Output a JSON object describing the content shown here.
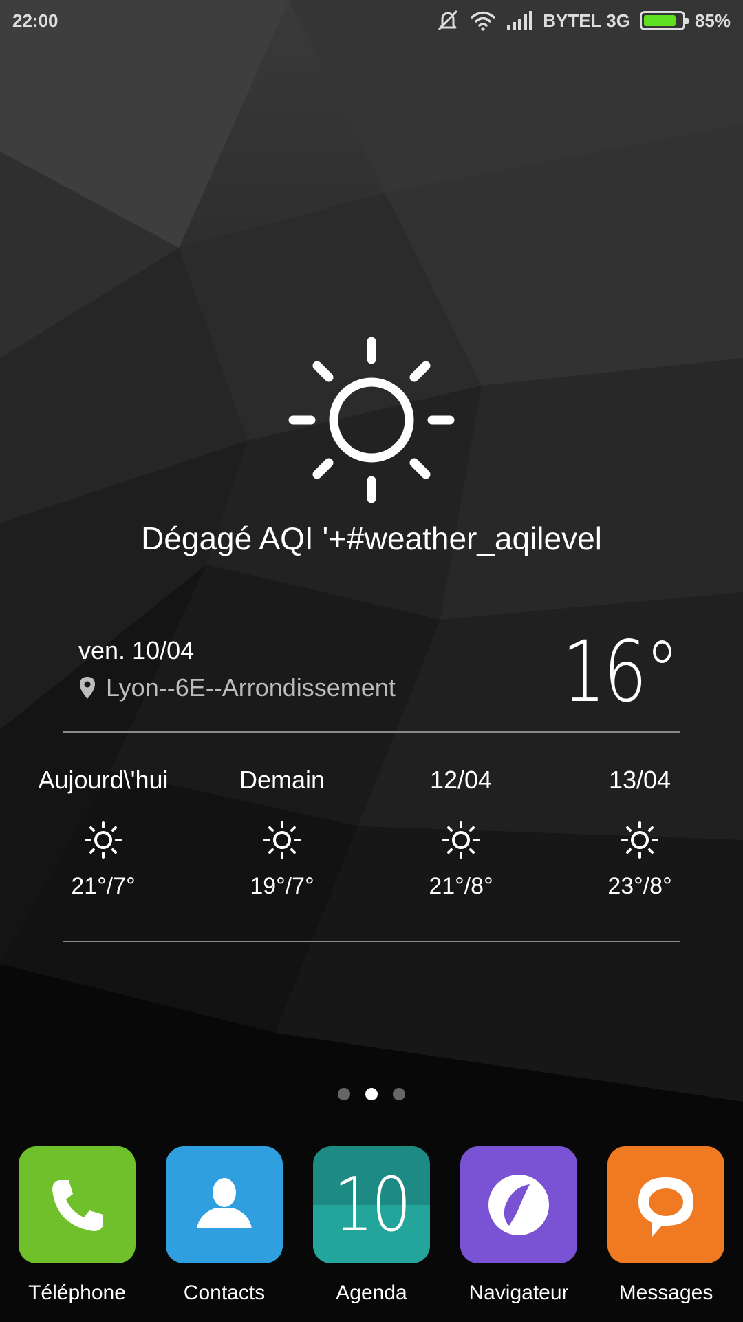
{
  "status_bar": {
    "time": "22:00",
    "carrier": "BYTEL 3G",
    "battery_percent_text": "85%",
    "battery_level": 0.85,
    "icons": [
      "mute-icon",
      "wifi-icon",
      "signal-icon",
      "battery-icon"
    ],
    "battery_color": "#5fe021"
  },
  "weather": {
    "condition": "Dégagé AQI '+#weather_aqilevel",
    "date": "ven. 10/04",
    "location": "Lyon--6E--Arrondissement",
    "current_temp": "16°",
    "icon": "sun-icon",
    "forecast": [
      {
        "label": "Aujourd\\'hui",
        "temps": "21°/7°",
        "icon": "sun-icon"
      },
      {
        "label": "Demain",
        "temps": "19°/7°",
        "icon": "sun-icon"
      },
      {
        "label": "12/04",
        "temps": "21°/8°",
        "icon": "sun-icon"
      },
      {
        "label": "13/04",
        "temps": "23°/8°",
        "icon": "sun-icon"
      }
    ]
  },
  "pager": {
    "count": 3,
    "active_index": 1
  },
  "dock": {
    "apps": [
      {
        "label": "Téléphone",
        "icon": "phone-icon",
        "color": "#6fc02a"
      },
      {
        "label": "Contacts",
        "icon": "contacts-icon",
        "color": "#2f9fe0"
      },
      {
        "label": "Agenda",
        "icon": "calendar-icon",
        "day": "10",
        "color": "#1d9a90"
      },
      {
        "label": "Navigateur",
        "icon": "browser-icon",
        "color": "#7a52d4"
      },
      {
        "label": "Messages",
        "icon": "messages-icon",
        "color": "#ef7a22"
      }
    ]
  }
}
